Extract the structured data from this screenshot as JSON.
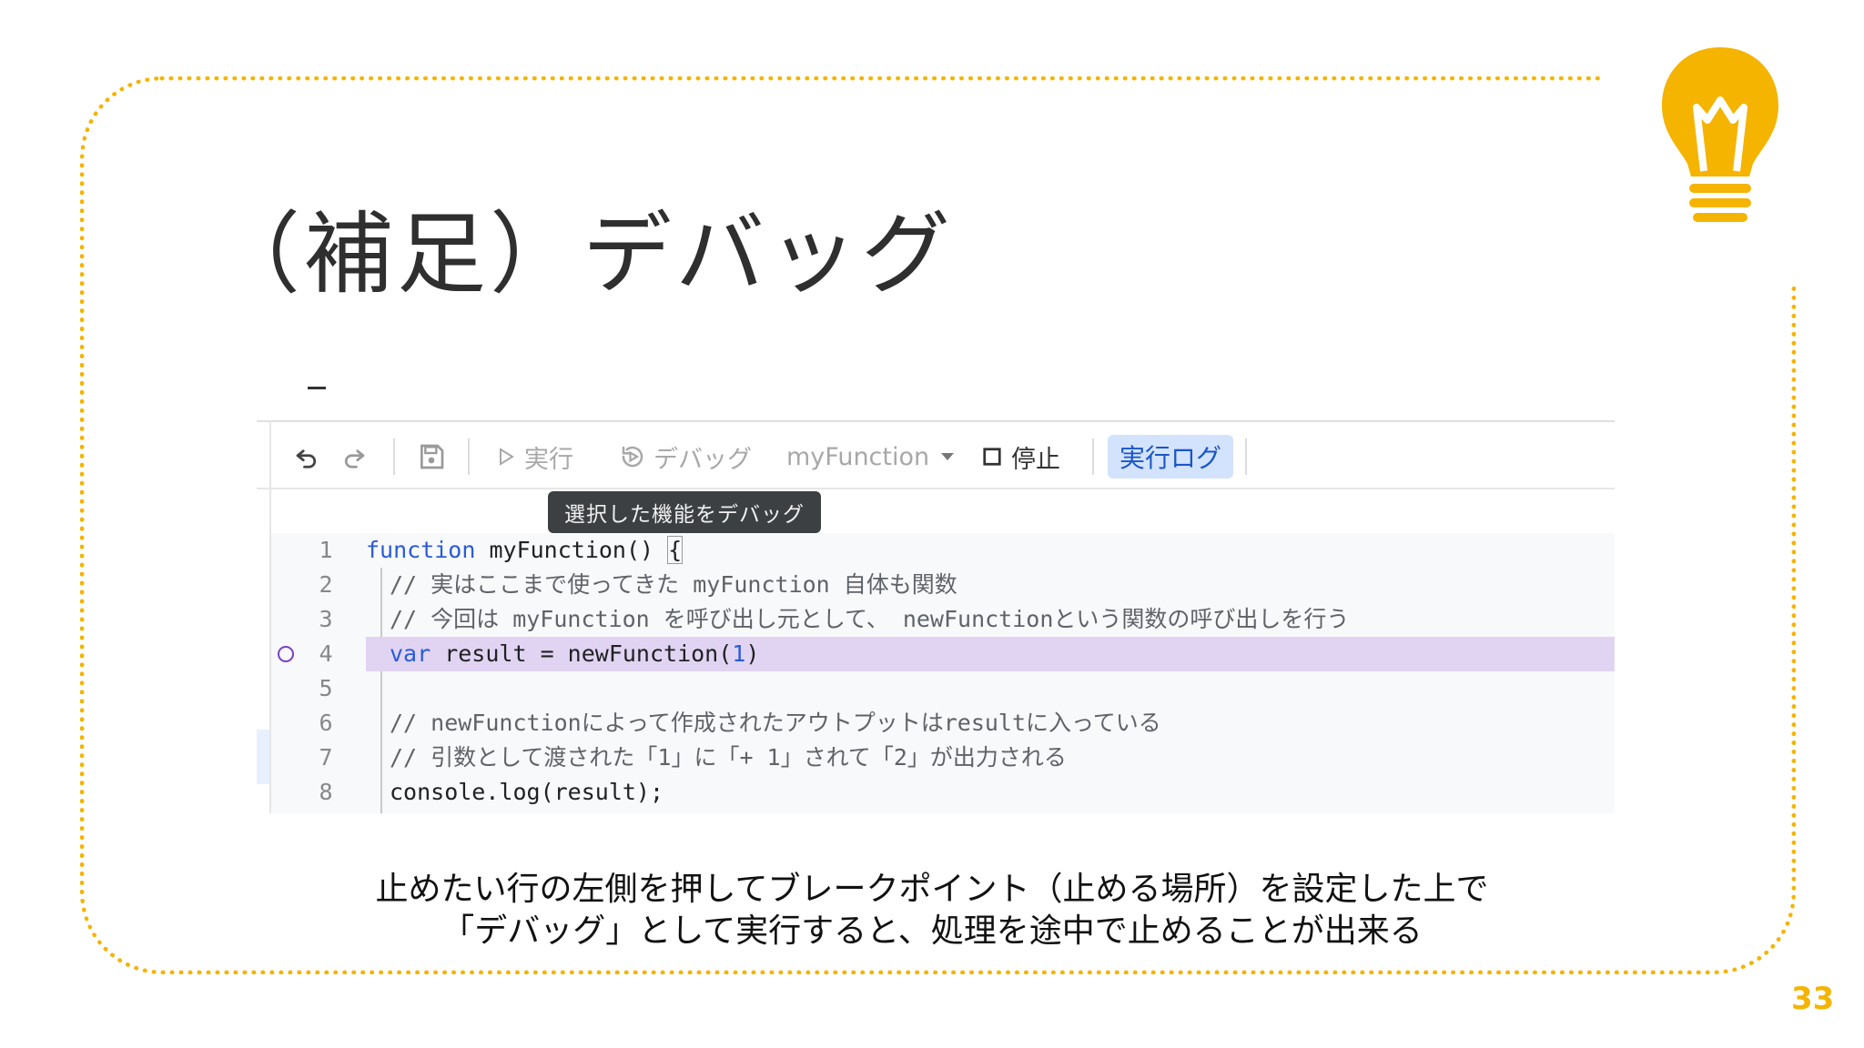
{
  "slide": {
    "title": "（補足）デバッグ",
    "page_number": "33",
    "caption_line1": "止めたい行の左側を押してブレークポイント（止める場所）を設定した上で",
    "caption_line2": "「デバッグ」として実行すると、処理を途中で止めることが出来る",
    "accent_color": "#f4b400"
  },
  "toolbar": {
    "run_label": "実行",
    "debug_label": "デバッグ",
    "function_select": "myFunction",
    "stop_label": "停止",
    "exec_log_label": "実行ログ",
    "icons": [
      "undo-icon",
      "redo-icon",
      "save-icon",
      "play-icon",
      "debug-icon",
      "dropdown-icon",
      "stop-icon"
    ]
  },
  "tooltip": {
    "text": "選択した機能をデバッグ"
  },
  "code": {
    "lines": [
      {
        "num": "1",
        "text": "function myFunction() {"
      },
      {
        "num": "2",
        "text": "// 実はここまで使ってきた myFunction 自体も関数"
      },
      {
        "num": "3",
        "text": "// 今回は myFunction を呼び出し元として、 newFunctionという関数の呼び出しを行う"
      },
      {
        "num": "4",
        "text": "var result = newFunction(1)"
      },
      {
        "num": "5",
        "text": ""
      },
      {
        "num": "6",
        "text": "// newFunctionによって作成されたアウトプットはresultに入っている"
      },
      {
        "num": "7",
        "text": "// 引数として渡された「1」に「+ 1」されて「2」が出力される"
      },
      {
        "num": "8",
        "text": "console.log(result);"
      }
    ],
    "breakpoint_line": "4",
    "highlight_color": "#e1d4f2"
  }
}
